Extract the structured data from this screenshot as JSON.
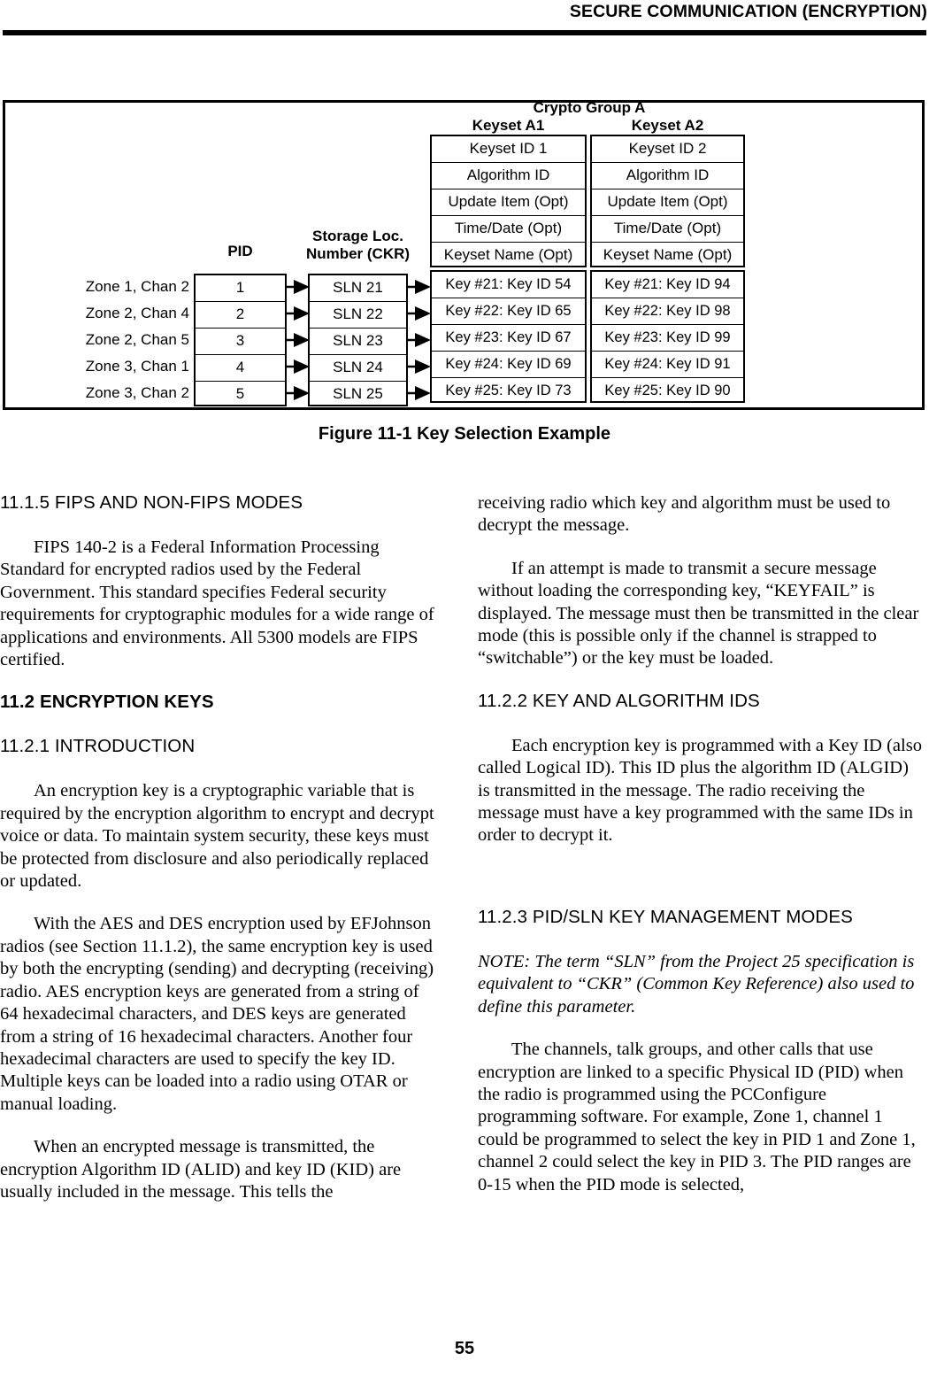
{
  "header": {
    "title": "SECURE COMMUNICATION (ENCRYPTION)"
  },
  "figure": {
    "caption": "Figure 11-1   Key Selection Example",
    "crypto_group_label": "Crypto Group A",
    "keyset_a1_label": "Keyset A1",
    "keyset_a2_label": "Keyset A2",
    "pid_heading": "PID",
    "sln_heading": "Storage Loc.\nNumber (CKR)",
    "zones": [
      "Zone 1, Chan 2",
      "Zone 2, Chan 4",
      "Zone 2, Chan 5",
      "Zone 3, Chan 1",
      "Zone 3, Chan 2"
    ],
    "pids": [
      "1",
      "2",
      "3",
      "4",
      "5"
    ],
    "slns": [
      "SLN 21",
      "SLN 22",
      "SLN 23",
      "SLN 24",
      "SLN 25"
    ],
    "keyset_a1_head": [
      "Keyset ID 1",
      "Algorithm ID",
      "Update Item (Opt)",
      "Time/Date (Opt)",
      "Keyset Name (Opt)"
    ],
    "keyset_a2_head": [
      "Keyset ID 2",
      "Algorithm ID",
      "Update Item (Opt)",
      "Time/Date (Opt)",
      "Keyset Name (Opt)"
    ],
    "keyset_a1_keys": [
      "Key #21: Key ID 54",
      "Key #22: Key ID 65",
      "Key #23: Key ID 67",
      "Key #24: Key ID 69",
      "Key #25: Key ID 73"
    ],
    "keyset_a2_keys": [
      "Key #21: Key ID 94",
      "Key #22: Key ID 98",
      "Key #23: Key ID 99",
      "Key #24: Key ID 91",
      "Key #25: Key ID 90"
    ]
  },
  "left_column": {
    "heading_1115": "11.1.5  FIPS AND NON-FIPS MODES",
    "para_fips": "FIPS 140-2 is a Federal Information Processing Standard for encrypted radios used by the Federal Government. This standard specifies Federal security requirements for cryptographic modules for a wide range of applications and environments. All 5300 models are FIPS certified.",
    "heading_112": "11.2 ENCRYPTION KEYS",
    "heading_1121": "11.2.1  INTRODUCTION",
    "para_intro_1": "An encryption key is a cryptographic variable that is required by the encryption algorithm to encrypt and decrypt voice or data. To maintain system security, these keys must be protected from disclosure and also periodically replaced or updated.",
    "para_intro_2": "With the AES and DES encryption used by EFJohnson radios (see Section 11.1.2), the same encryption key is used by both the encrypting (sending) and decrypting (receiving) radio. AES encryption keys are generated from a string of 64 hexadecimal characters, and DES keys are generated from a string of 16 hexadecimal characters. Another four hexadecimal characters are used to specify the key ID. Multiple keys can be loaded into a radio using OTAR or manual loading.",
    "para_intro_3": "When an encrypted message is transmitted, the encryption Algorithm ID (ALID) and key ID (KID) are usually included in the message. This tells the"
  },
  "right_column": {
    "para_continued": "receiving radio which key and algorithm must be used to decrypt the message.",
    "para_keyfail": "If an attempt is made to transmit a secure message without loading the corresponding key, “KEYFAIL” is displayed. The message must then be transmitted in the clear mode (this is possible only if the channel is strapped to “switchable”) or the key must be loaded.",
    "heading_1122": "11.2.2  KEY AND ALGORITHM IDS",
    "para_keyids": "Each encryption key is programmed with a Key ID (also called Logical ID). This ID plus the algorithm ID (ALGID) is transmitted in the message. The radio receiving the message must have a key programmed with the same IDs in order to decrypt it.",
    "heading_1123": "11.2.3  PID/SLN KEY MANAGEMENT MODES",
    "note_sln": "NOTE: The term “SLN” from the Project 25 specification is equivalent to “CKR” (Common Key Reference) also used to define this parameter.",
    "para_pid": "The channels, talk groups, and other calls that use encryption are linked to a specific Physical ID (PID) when the radio is programmed using the PCConfigure programming software. For example, Zone 1, channel 1 could be programmed to select the key in PID 1 and Zone 1, channel 2 could select the key in PID 3. The PID ranges are 0-15 when the PID mode is selected,"
  },
  "footer": {
    "page_number": "55"
  }
}
